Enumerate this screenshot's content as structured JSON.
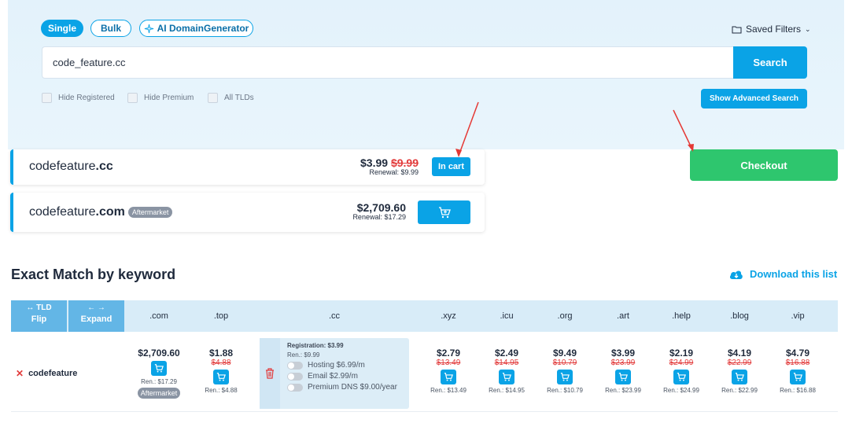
{
  "search": {
    "modes": [
      "Single",
      "Bulk",
      "AI DomainGenerator"
    ],
    "saved_filters": "Saved Filters",
    "query": "code_feature.cc",
    "button": "Search",
    "filters": [
      "Hide Registered",
      "Hide Premium",
      "All TLDs"
    ],
    "advanced": "Show Advanced Search"
  },
  "cart_items": [
    {
      "sld": "codefeature",
      "tld": ".cc",
      "price": "$3.99",
      "old_price": "$9.99",
      "renewal": "Renewal: $9.99",
      "action": "In cart"
    },
    {
      "sld": "codefeature",
      "tld": ".com",
      "badge": "Aftermarket",
      "price": "$2,709.60",
      "renewal": "Renewal: $17.29"
    }
  ],
  "checkout": "Checkout",
  "exact_match": {
    "title": "Exact Match by keyword",
    "download": "Download this list",
    "flip": {
      "top": "↔ TLD",
      "label": "Flip"
    },
    "expand": {
      "top": "← →",
      "label": "Expand"
    },
    "columns": [
      ".com",
      ".top",
      ".cc",
      ".xyz",
      ".icu",
      ".org",
      ".art",
      ".help",
      ".blog",
      ".vip"
    ],
    "keyword": "codefeature",
    "cells": {
      "com": {
        "price": "$2,709.60",
        "ren": "Ren.: $17.29",
        "badge": "Aftermarket"
      },
      "top": {
        "price": "$1.88",
        "old": "$4.88",
        "ren": "Ren.: $4.88"
      },
      "cc": {
        "registration": "Registration: $3.99",
        "ren": "Ren.: $9.99",
        "options": [
          "Hosting $6.99/m",
          "Email $2.99/m",
          "Premium DNS $9.00/year"
        ]
      },
      "xyz": {
        "price": "$2.79",
        "old": "$13.49",
        "ren": "Ren.: $13.49"
      },
      "icu": {
        "price": "$2.49",
        "old": "$14.95",
        "ren": "Ren.: $14.95"
      },
      "org": {
        "price": "$9.49",
        "old": "$10.79",
        "ren": "Ren.: $10.79"
      },
      "art": {
        "price": "$3.99",
        "old": "$23.99",
        "ren": "Ren.: $23.99"
      },
      "help": {
        "price": "$2.19",
        "old": "$24.99",
        "ren": "Ren.: $24.99"
      },
      "blog": {
        "price": "$4.19",
        "old": "$22.99",
        "ren": "Ren.: $22.99"
      },
      "vip": {
        "price": "$4.79",
        "old": "$16.88",
        "ren": "Ren.: $16.88"
      }
    }
  },
  "colors": {
    "accent": "#0aa3e6",
    "checkout": "#2ec66e",
    "strike": "#e23b3b",
    "arrow": "#e53935"
  }
}
